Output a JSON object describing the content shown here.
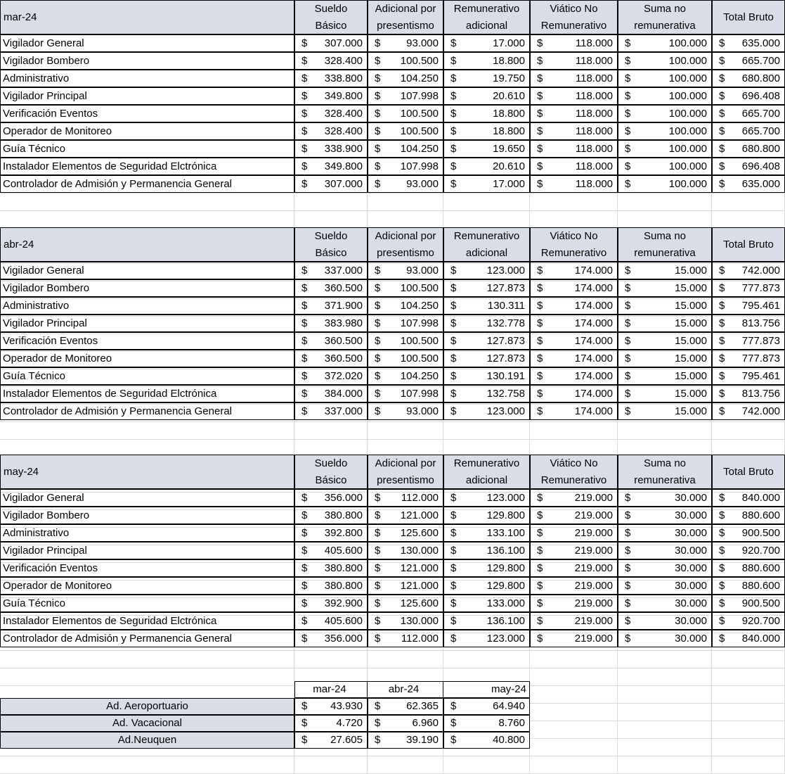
{
  "headers": {
    "sueldo": [
      "Sueldo",
      "Básico"
    ],
    "adicional": [
      "Adicional por",
      "presentismo"
    ],
    "remunerativo": [
      "Remunerativo",
      "adicional"
    ],
    "viatico": [
      "Viático No",
      "Remunerativo"
    ],
    "suma": [
      "Suma no",
      "remunerativa"
    ],
    "total": "Total Bruto",
    "currency": "$"
  },
  "periods": [
    {
      "label": "mar-24",
      "rows": [
        {
          "role": "Vigilador General",
          "values": [
            "307.000",
            "93.000",
            "17.000",
            "118.000",
            "100.000",
            "635.000"
          ]
        },
        {
          "role": "Vigilador Bombero",
          "values": [
            "328.400",
            "100.500",
            "18.800",
            "118.000",
            "100.000",
            "665.700"
          ]
        },
        {
          "role": "Administrativo",
          "values": [
            "338.800",
            "104.250",
            "19.750",
            "118.000",
            "100.000",
            "680.800"
          ]
        },
        {
          "role": "Vigilador Principal",
          "values": [
            "349.800",
            "107.998",
            "20.610",
            "118.000",
            "100.000",
            "696.408"
          ]
        },
        {
          "role": "Verificación Eventos",
          "values": [
            "328.400",
            "100.500",
            "18.800",
            "118.000",
            "100.000",
            "665.700"
          ]
        },
        {
          "role": "Operador de Monitoreo",
          "values": [
            "328.400",
            "100.500",
            "18.800",
            "118.000",
            "100.000",
            "665.700"
          ]
        },
        {
          "role": "Guía Técnico",
          "values": [
            "338.900",
            "104.250",
            "19.650",
            "118.000",
            "100.000",
            "680.800"
          ]
        },
        {
          "role": "Instalador Elementos de Seguridad Elctrónica",
          "values": [
            "349.800",
            "107.998",
            "20.610",
            "118.000",
            "100.000",
            "696.408"
          ]
        },
        {
          "role": "Controlador de Admisión y Permanencia General",
          "values": [
            "307.000",
            "93.000",
            "17.000",
            "118.000",
            "100.000",
            "635.000"
          ]
        }
      ]
    },
    {
      "label": "abr-24",
      "rows": [
        {
          "role": "Vigilador General",
          "values": [
            "337.000",
            "93.000",
            "123.000",
            "174.000",
            "15.000",
            "742.000"
          ]
        },
        {
          "role": "Vigilador Bombero",
          "values": [
            "360.500",
            "100.500",
            "127.873",
            "174.000",
            "15.000",
            "777.873"
          ]
        },
        {
          "role": "Administrativo",
          "values": [
            "371.900",
            "104.250",
            "130.311",
            "174.000",
            "15.000",
            "795.461"
          ]
        },
        {
          "role": "Vigilador Principal",
          "values": [
            "383.980",
            "107.998",
            "132.778",
            "174.000",
            "15.000",
            "813.756"
          ]
        },
        {
          "role": "Verificación Eventos",
          "values": [
            "360.500",
            "100.500",
            "127.873",
            "174.000",
            "15.000",
            "777.873"
          ]
        },
        {
          "role": "Operador de Monitoreo",
          "values": [
            "360.500",
            "100.500",
            "127.873",
            "174.000",
            "15.000",
            "777.873"
          ]
        },
        {
          "role": "Guía Técnico",
          "values": [
            "372.020",
            "104.250",
            "130.191",
            "174.000",
            "15.000",
            "795.461"
          ]
        },
        {
          "role": "Instalador Elementos de Seguridad Elctrónica",
          "values": [
            "384.000",
            "107.998",
            "132.758",
            "174.000",
            "15.000",
            "813.756"
          ]
        },
        {
          "role": "Controlador de Admisión y Permanencia General",
          "values": [
            "337.000",
            "93.000",
            "123.000",
            "174.000",
            "15.000",
            "742.000"
          ]
        }
      ]
    },
    {
      "label": "may-24",
      "rows": [
        {
          "role": "Vigilador General",
          "values": [
            "356.000",
            "112.000",
            "123.000",
            "219.000",
            "30.000",
            "840.000"
          ]
        },
        {
          "role": "Vigilador Bombero",
          "values": [
            "380.800",
            "121.000",
            "129.800",
            "219.000",
            "30.000",
            "880.600"
          ]
        },
        {
          "role": "Administrativo",
          "values": [
            "392.800",
            "125.600",
            "133.100",
            "219.000",
            "30.000",
            "900.500"
          ]
        },
        {
          "role": "Vigilador Principal",
          "values": [
            "405.600",
            "130.000",
            "136.100",
            "219.000",
            "30.000",
            "920.700"
          ]
        },
        {
          "role": "Verificación Eventos",
          "values": [
            "380.800",
            "121.000",
            "129.800",
            "219.000",
            "30.000",
            "880.600"
          ]
        },
        {
          "role": "Operador de Monitoreo",
          "values": [
            "380.800",
            "121.000",
            "129.800",
            "219.000",
            "30.000",
            "880.600"
          ]
        },
        {
          "role": "Guía Técnico",
          "values": [
            "392.900",
            "125.600",
            "133.000",
            "219.000",
            "30.000",
            "900.500"
          ]
        },
        {
          "role": "Instalador Elementos de Seguridad Elctrónica",
          "values": [
            "405.600",
            "130.000",
            "136.100",
            "219.000",
            "30.000",
            "920.700"
          ]
        },
        {
          "role": "Controlador de Admisión y Permanencia General",
          "values": [
            "356.000",
            "112.000",
            "123.000",
            "219.000",
            "30.000",
            "840.000"
          ]
        }
      ]
    }
  ],
  "summary": {
    "months": [
      "mar-24",
      "abr-24",
      "may-24"
    ],
    "rows": [
      {
        "label": "Ad. Aeroportuario",
        "values": [
          "43.930",
          "62.365",
          "64.940"
        ]
      },
      {
        "label": "Ad. Vacacional",
        "values": [
          "4.720",
          "6.960",
          "8.760"
        ]
      },
      {
        "label": "Ad.Neuquen",
        "values": [
          "27.605",
          "39.190",
          "40.800"
        ]
      }
    ]
  }
}
